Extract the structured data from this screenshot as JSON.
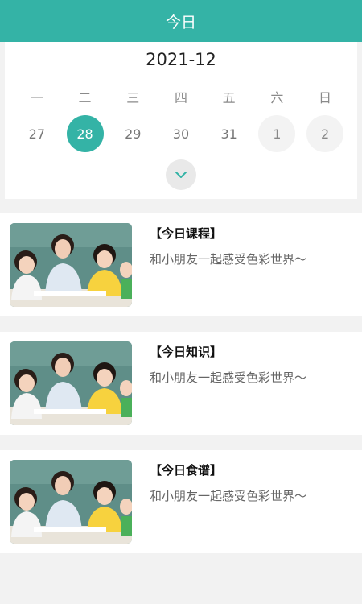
{
  "header": {
    "title": "今日"
  },
  "calendar": {
    "month": "2021-12",
    "weekdays": [
      "一",
      "二",
      "三",
      "四",
      "五",
      "六",
      "日"
    ],
    "dates": [
      "27",
      "28",
      "29",
      "30",
      "31",
      "1",
      "2"
    ],
    "selected_index": 1
  },
  "items": [
    {
      "title": "【今日课程】",
      "desc": "和小朋友一起感受色彩世界～"
    },
    {
      "title": "【今日知识】",
      "desc": "和小朋友一起感受色彩世界～"
    },
    {
      "title": "【今日食谱】",
      "desc": "和小朋友一起感受色彩世界～"
    }
  ],
  "colors": {
    "accent": "#34b3a6"
  }
}
